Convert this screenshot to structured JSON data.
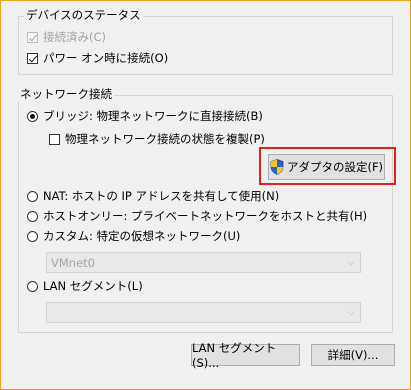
{
  "device_status": {
    "title": "デバイスのステータス",
    "connected": {
      "label": "接続済み(C)",
      "checked": true,
      "enabled": false
    },
    "connect_at_power_on": {
      "label": "パワー オン時に接続(O)",
      "checked": true,
      "enabled": true
    }
  },
  "network": {
    "title": "ネットワーク接続",
    "bridged": {
      "label": "ブリッジ: 物理ネットワークに直接接続(B)",
      "selected": true
    },
    "replicate_state": {
      "label": "物理ネットワーク接続の状態を複製(P)",
      "checked": false
    },
    "adapter_settings_button": "アダプタの設定(F)",
    "nat": {
      "label": "NAT: ホストの IP アドレスを共有して使用(N)",
      "selected": false
    },
    "host_only": {
      "label": "ホストオンリー: プライベートネットワークをホストと共有(H)",
      "selected": false
    },
    "custom": {
      "label": "カスタム: 特定の仮想ネットワーク(U)",
      "selected": false
    },
    "custom_select_value": "VMnet0",
    "lan_segment": {
      "label": "LAN セグメント(L)",
      "selected": false
    },
    "lan_segment_select_value": ""
  },
  "footer": {
    "lan_segments_button": "LAN セグメント(S)...",
    "advanced_button": "詳細(V)..."
  },
  "colors": {
    "highlight": "#e41e20",
    "window_border": "#e8a317"
  },
  "icons": {
    "adapter_button_icon": "uac-shield-icon",
    "select_arrow": "chevron-down-icon"
  }
}
